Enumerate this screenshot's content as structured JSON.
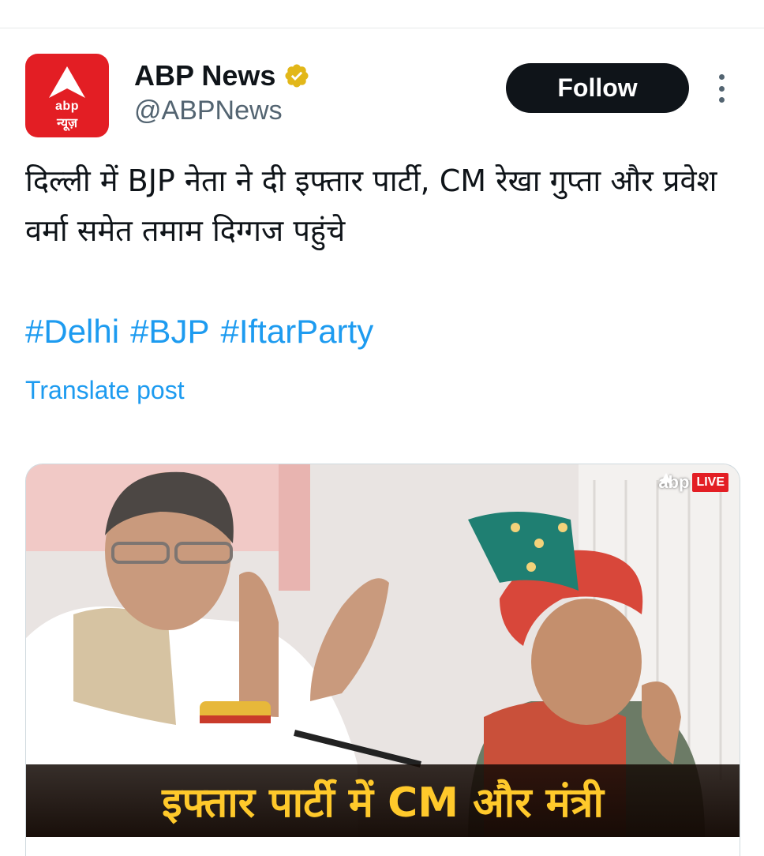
{
  "account": {
    "name": "ABP News",
    "handle": "@ABPNews",
    "avatar_text": "abp",
    "avatar_hindi": "न्यूज़",
    "verified": true,
    "verified_color": "#e2b719"
  },
  "actions": {
    "follow_label": "Follow"
  },
  "post": {
    "text": "दिल्ली में BJP नेता ने दी इफ्तार पार्टी, CM रेखा गुप्ता और प्रवेश वर्मा समेत तमाम दिग्गज पहुंचे",
    "hashtags": [
      "#Delhi",
      "#BJP",
      "#IftarParty"
    ],
    "translate_label": "Translate post"
  },
  "media": {
    "brand": "abp",
    "live_badge": "LIVE",
    "caption": "इफ्तार पार्टी में CM और मंत्री"
  },
  "colors": {
    "link": "#1d9bf0",
    "follow_bg": "#0f1419",
    "brand_red": "#e31e24",
    "caption_text": "#ffc92b"
  }
}
